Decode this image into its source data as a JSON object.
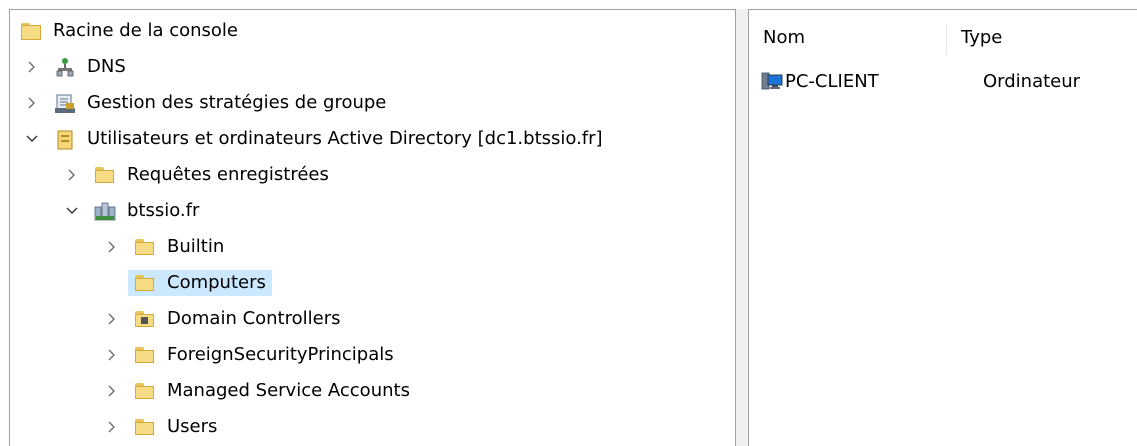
{
  "tree": {
    "root": "Racine de la console",
    "dns": "DNS",
    "gpo": "Gestion des stratégies de groupe",
    "aduc": "Utilisateurs et ordinateurs Active Directory [dc1.btssio.fr]",
    "saved_queries": "Requêtes enregistrées",
    "domain": "btssio.fr",
    "builtin": "Builtin",
    "computers": "Computers",
    "domain_controllers": "Domain Controllers",
    "fsp": "ForeignSecurityPrincipals",
    "msa": "Managed Service Accounts",
    "users": "Users"
  },
  "list": {
    "columns": [
      "Nom",
      "Type"
    ],
    "rows": [
      {
        "name": "PC-CLIENT",
        "type": "Ordinateur",
        "icon": "computer-icon"
      }
    ]
  },
  "colors": {
    "selection": "#cce8ff",
    "folder": "#f7dc86",
    "border": "#a0a0a0"
  }
}
